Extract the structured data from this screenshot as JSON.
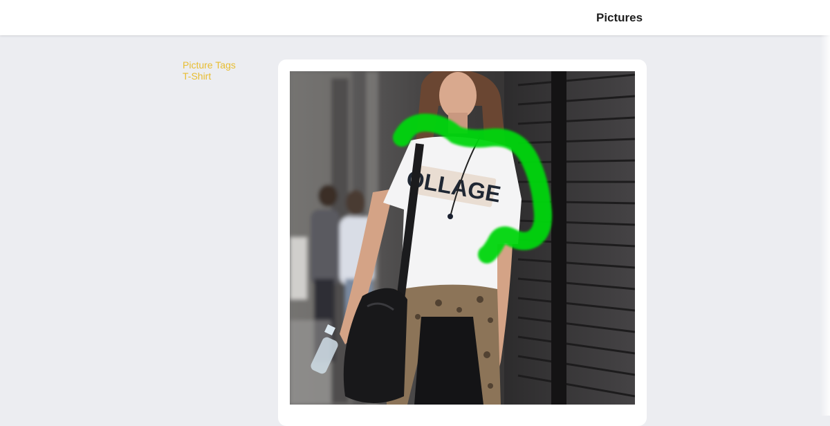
{
  "header": {
    "title": "Pictures"
  },
  "sidebar": {
    "heading": "Picture Tags",
    "tags": [
      "T-Shirt"
    ]
  },
  "photo": {
    "shirt_print": "OLLAGE",
    "highlight_color": "#00d60a"
  }
}
